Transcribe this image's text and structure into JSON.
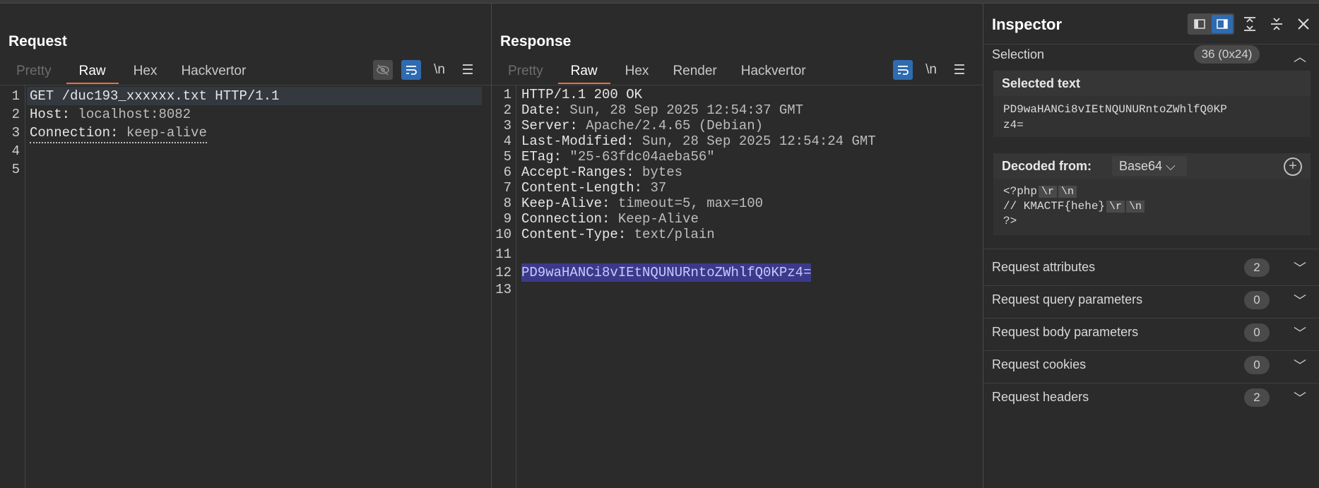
{
  "request": {
    "title": "Request",
    "tabs": [
      "Pretty",
      "Raw",
      "Hex",
      "Hackvertor"
    ],
    "active_tab": "Raw",
    "newline_label": "\\n",
    "lines": [
      {
        "num": "1",
        "key": "GET /duc193_xxxxxx.txt HTTP/1.1",
        "val": ""
      },
      {
        "num": "2",
        "key": "Host: ",
        "val": "localhost:8082"
      },
      {
        "num": "3",
        "key": "Connection: ",
        "val": "keep-alive"
      },
      {
        "num": "4",
        "key": "",
        "val": ""
      },
      {
        "num": "5",
        "key": "",
        "val": ""
      }
    ]
  },
  "response": {
    "title": "Response",
    "tabs": [
      "Pretty",
      "Raw",
      "Hex",
      "Render",
      "Hackvertor"
    ],
    "active_tab": "Raw",
    "newline_label": "\\n",
    "lines": [
      {
        "num": "1",
        "key": "HTTP/1.1 200 OK",
        "val": ""
      },
      {
        "num": "2",
        "key": "Date: ",
        "val": "Sun, 28 Sep 2025 12:54:37 GMT"
      },
      {
        "num": "3",
        "key": "Server: ",
        "val": "Apache/2.4.65 (Debian)"
      },
      {
        "num": "4",
        "key": "Last-Modified: ",
        "val": "Sun, 28 Sep 2025 12:54:24 GMT"
      },
      {
        "num": "5",
        "key": "ETag: ",
        "val": "\"25-63fdc04aeba56\""
      },
      {
        "num": "6",
        "key": "Accept-Ranges: ",
        "val": "bytes"
      },
      {
        "num": "7",
        "key": "Content-Length: ",
        "val": "37"
      },
      {
        "num": "8",
        "key": "Keep-Alive: ",
        "val": "timeout=5, max=100"
      },
      {
        "num": "9",
        "key": "Connection: ",
        "val": "Keep-Alive"
      },
      {
        "num": "10",
        "key": "Content-Type: ",
        "val": "text/plain"
      },
      {
        "num": "11",
        "key": "",
        "val": ""
      },
      {
        "num": "12",
        "key": "",
        "val": "PD9waHANCi8vIEtNQUNURntoZWhlfQ0KPz4="
      },
      {
        "num": "13",
        "key": "",
        "val": ""
      }
    ]
  },
  "inspector": {
    "title": "Inspector",
    "selection_label": "Selection",
    "selection_badge": "36 (0x24)",
    "selected_text_title": "Selected text",
    "selected_text_line1": "PD9waHANCi8vIEtNQUNURntoZWhlfQ0KP",
    "selected_text_line2": "z4=",
    "decoded_from_label": "Decoded from:",
    "decoded_from_value": "Base64",
    "decoded": {
      "l1": "<?php",
      "l2": "// KMACTF{hehe}",
      "l3": "?>",
      "esc_r": "\\r",
      "esc_n": "\\n"
    },
    "sections": [
      {
        "label": "Request attributes",
        "count": "2"
      },
      {
        "label": "Request query parameters",
        "count": "0"
      },
      {
        "label": "Request body parameters",
        "count": "0"
      },
      {
        "label": "Request cookies",
        "count": "0"
      },
      {
        "label": "Request headers",
        "count": "2"
      }
    ]
  }
}
